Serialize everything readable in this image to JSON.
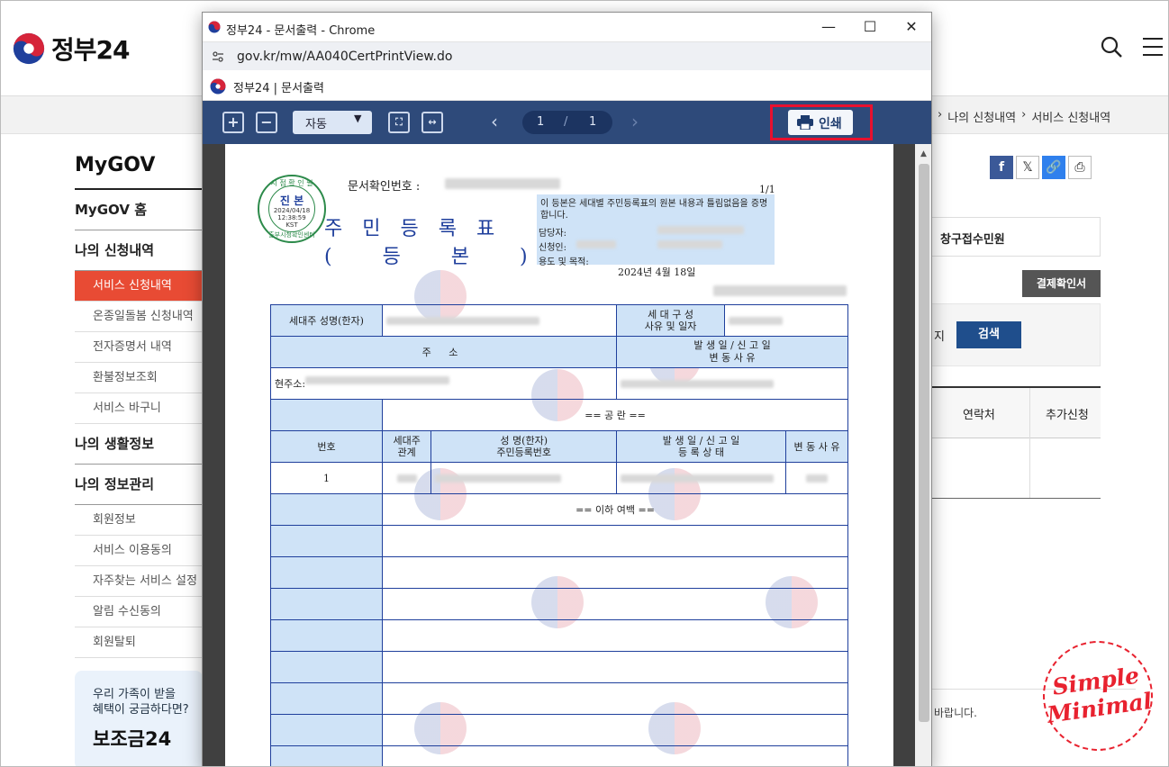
{
  "site": {
    "logo_text": "정부24",
    "breadcrumb": [
      "나의 신청내역",
      "서비스 신청내역"
    ],
    "sidebar_title": "MyGOV",
    "sidebar": [
      {
        "label": "MyGOV 홈",
        "kind": "group"
      },
      {
        "label": "나의 신청내역",
        "kind": "group"
      },
      {
        "label": "서비스 신청내역",
        "kind": "active"
      },
      {
        "label": "온종일돌봄 신청내역",
        "kind": "sub"
      },
      {
        "label": "전자증명서 내역",
        "kind": "sub"
      },
      {
        "label": "환불정보조회",
        "kind": "sub"
      },
      {
        "label": "서비스 바구니",
        "kind": "sub"
      },
      {
        "label": "나의 생활정보",
        "kind": "group"
      },
      {
        "label": "나의 정보관리",
        "kind": "group"
      },
      {
        "label": "회원정보",
        "kind": "sub"
      },
      {
        "label": "서비스 이용동의",
        "kind": "sub"
      },
      {
        "label": "자주찾는 서비스 설정",
        "kind": "sub"
      },
      {
        "label": "알림 수신동의",
        "kind": "sub"
      },
      {
        "label": "회원탈퇴",
        "kind": "sub"
      }
    ],
    "promo": {
      "line1": "우리 가족이 받을",
      "line2": "혜택이 궁금하다면?",
      "big": "보조금24"
    },
    "panel_label": "창구접수민원",
    "receipt_button": "결제확인서",
    "filter_tail": "지",
    "search_button": "검색",
    "table_headers": [
      "연락처",
      "추가신청"
    ],
    "notice_tail": "바랍니다.",
    "stamp_line1": "Simple",
    "stamp_line2": "Minimal"
  },
  "popup": {
    "window_title": "정부24 - 문서출력 - Chrome",
    "url": "gov.kr/mw/AA040CertPrintView.do",
    "brand": "정부24",
    "brand_page": "문서출력",
    "toolbar": {
      "zoom_mode": "자동",
      "current_page": "1",
      "page_sep": "/",
      "total_pages": "1",
      "print_label": "인쇄"
    },
    "doc": {
      "seal_top": "시 점 확 인 필",
      "seal_main": "진 본",
      "seal_date": "2024/04/18",
      "seal_time": "12:38:59",
      "seal_tz": "KST",
      "seal_bottom": "출부시청확인센터",
      "docno_label": "문서확인번호 :",
      "page_no": "1/1",
      "title": "주민등록표",
      "subtitle": "(  등  본  )",
      "cert_text": "이 등본은 세대별 주민등록표의 원본 내용과 틀림없음을 증명합니다.",
      "person_label": "담당자:",
      "applicant_label": "신청인:",
      "purpose_label": "용도 및 목적:",
      "issue_date": "2024년 4월 18일",
      "householder_label": "세대주 성명(한자)",
      "household_reason": "세 대 구 성\n사유 및 일자",
      "address_header": "주           소",
      "date_header": "발 생 일 / 신 고 일",
      "change_header": "변   동   사   유",
      "current_address": "현주소:",
      "vacant": "==  공  란  ==",
      "col_no": "번호",
      "col_rel_1": "세대주",
      "col_rel_2": "관계",
      "col_name_1": "성 명(한자)",
      "col_name_2": "주민등록번호",
      "col_date_1": "발 생 일 / 신 고 일",
      "col_date_2": "등 록 상 태",
      "col_reason": "변 동 사 유",
      "row_no": "1",
      "end_blank": "== 이하 여백 =="
    }
  }
}
